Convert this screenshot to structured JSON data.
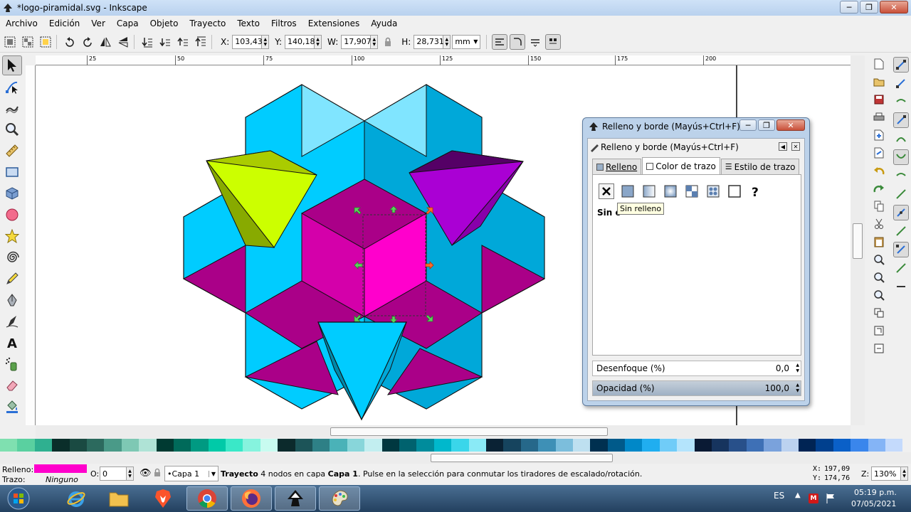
{
  "window": {
    "title": "*logo-piramidal.svg - Inkscape",
    "buttons": {
      "minimize": "─",
      "maximize": "❐",
      "close": "✕"
    }
  },
  "menu": [
    "Archivo",
    "Edición",
    "Ver",
    "Capa",
    "Objeto",
    "Trayecto",
    "Texto",
    "Filtros",
    "Extensiones",
    "Ayuda"
  ],
  "controls": {
    "x_label": "X:",
    "x_value": "103,433",
    "y_label": "Y:",
    "y_value": "140,183",
    "w_label": "W:",
    "w_value": "17,907",
    "h_label": "H:",
    "h_value": "28,731",
    "unit": "mm"
  },
  "ruler_labels": [
    "25",
    "50",
    "75",
    "100",
    "125",
    "150",
    "175",
    "200"
  ],
  "dialog": {
    "window_title": "Relleno y borde (Mayús+Ctrl+F)",
    "dock_title": "Relleno y borde (Mayús+Ctrl+F)",
    "tabs": [
      "Relleno",
      "Color de trazo",
      "Estilo de trazo"
    ],
    "active_tab": "Color de trazo",
    "paint_types": [
      "no-paint",
      "flat-color",
      "linear-gradient",
      "radial-gradient",
      "pattern",
      "swatch",
      "unset",
      "unknown"
    ],
    "tooltip": "Sin relleno",
    "none_label": "Sin c",
    "blur_label": "Desenfoque (%)",
    "blur_value": "0,0",
    "opacity_label": "Opacidad (%)",
    "opacity_value": "100,0"
  },
  "status": {
    "fill_label": "Relleno:",
    "stroke_label": "Trazo:",
    "fill_color": "#ff00cc",
    "stroke_value": "Ninguno",
    "opacity_label": "O:",
    "opacity_value": "0",
    "layer": "•Capa 1",
    "message_bold": "Trayecto",
    "message_mid": " 4 nodos en capa ",
    "message_layer": "Capa 1",
    "message_end": ". Pulse en la selección para conmutar los tiradores de escalado/rotación.",
    "x_label": "X:",
    "x_value": "197,09",
    "y_label": "Y:",
    "y_value": "174,76",
    "zoom_label": "Z:",
    "zoom_value": "130%"
  },
  "taskbar": {
    "language": "ES",
    "time": "05:19 p.m.",
    "date": "07/05/2021"
  },
  "colors": {
    "cyan": "#00ccff",
    "cyan_dark": "#00a8d9",
    "cyan_light": "#80e5ff",
    "magenta": "#aa0088",
    "magenta_bright": "#ff00cc",
    "magenta_mid": "#d400aa",
    "lime": "#ccff00",
    "lime_dark": "#88aa00",
    "purple": "#aa00d4",
    "purple_dark": "#550066"
  }
}
